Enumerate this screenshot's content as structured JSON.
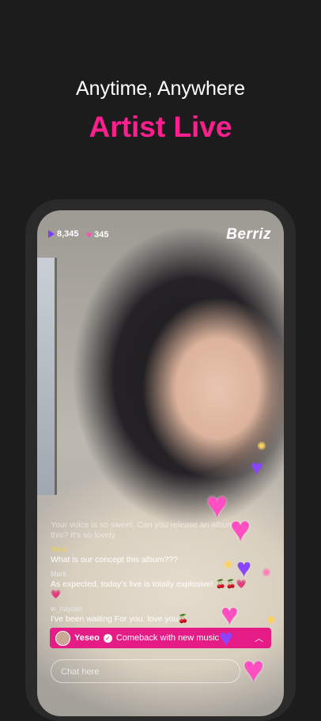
{
  "headline": {
    "line1": "Anytime, Anywhere",
    "line2": "Artist Live"
  },
  "stats": {
    "plays": "8,345",
    "hearts": "345"
  },
  "brand": "Berriz",
  "chat": [
    {
      "user": "",
      "message": "Your voice is so sweet. Can you release an album? this? It's so lovely",
      "faded": true
    },
    {
      "user": "Yeho",
      "message": "What is our concept this album???"
    },
    {
      "user": "Mark",
      "message": "As expected, today's live is totally explosive! 🍒🍒💗💗"
    },
    {
      "user": "w_hayden",
      "message": "I've been waiting For you. love you🍒"
    }
  ],
  "pinned": {
    "name": "Yeseo",
    "message": "Comeback with new music"
  },
  "input": {
    "placeholder": "Chat here"
  },
  "colors": {
    "accent": "#ff1f8e",
    "pin": "#e61c86",
    "background": "#1c1c1c"
  },
  "icons": {
    "play": "play-icon",
    "heart": "heart-icon",
    "verified": "check-icon",
    "chevron": "chevron-up-icon"
  }
}
